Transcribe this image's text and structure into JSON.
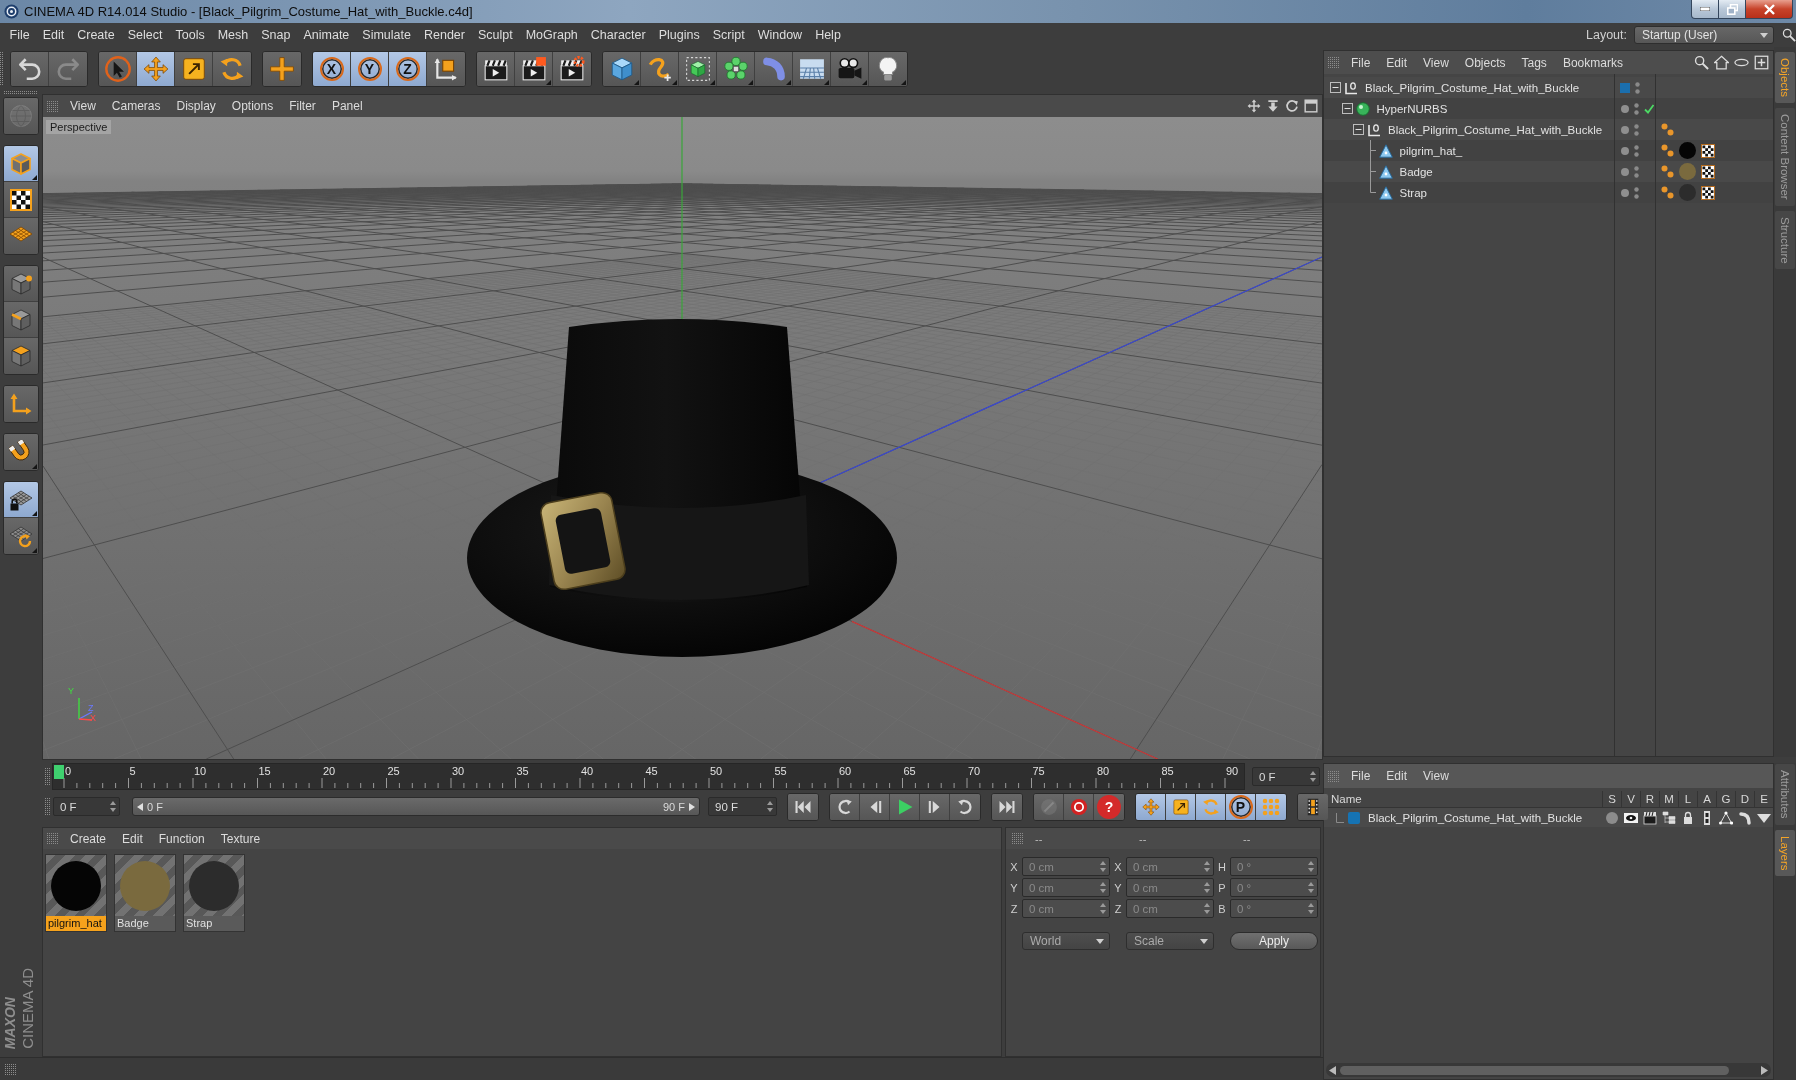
{
  "window": {
    "title": "CINEMA 4D R14.014 Studio - [Black_Pilgrim_Costume_Hat_with_Buckle.c4d]"
  },
  "menu": [
    "File",
    "Edit",
    "Create",
    "Select",
    "Tools",
    "Mesh",
    "Snap",
    "Animate",
    "Simulate",
    "Render",
    "Sculpt",
    "MoGraph",
    "Character",
    "Plugins",
    "Script",
    "Window",
    "Help"
  ],
  "layout": {
    "label": "Layout:",
    "value": "Startup (User)"
  },
  "toolbar": [
    {
      "buttons": [
        {
          "kind": "undo",
          "selected": false,
          "disabled": false
        },
        {
          "kind": "redo",
          "selected": false,
          "disabled": true
        }
      ]
    },
    {
      "buttons": [
        {
          "kind": "select",
          "selected": false
        },
        {
          "kind": "move",
          "selected": true
        },
        {
          "kind": "scale",
          "selected": false
        },
        {
          "kind": "rotate",
          "selected": false
        }
      ]
    },
    {
      "buttons": [
        {
          "kind": "add",
          "selected": false
        }
      ]
    },
    {
      "buttons": [
        {
          "kind": "axis",
          "label": "X",
          "selected": true
        },
        {
          "kind": "axis",
          "label": "Y",
          "selected": true
        },
        {
          "kind": "axis",
          "label": "Z",
          "selected": true
        },
        {
          "kind": "coords",
          "selected": false
        }
      ]
    },
    {
      "buttons": [
        {
          "kind": "render_view",
          "selected": false
        },
        {
          "kind": "render_picture",
          "selected": false
        },
        {
          "kind": "render_settings",
          "selected": false
        }
      ]
    },
    {
      "buttons": [
        {
          "kind": "cube",
          "selected": false
        },
        {
          "kind": "spline",
          "selected": false
        },
        {
          "kind": "nurbs",
          "selected": false
        },
        {
          "kind": "cloner",
          "selected": false
        },
        {
          "kind": "deformer",
          "selected": false
        },
        {
          "kind": "floor",
          "selected": false
        },
        {
          "kind": "camera",
          "selected": false
        },
        {
          "kind": "light",
          "selected": false
        }
      ]
    }
  ],
  "left_toolbar": [
    {
      "buttons": [
        {
          "kind": "globe",
          "selected": false,
          "disabled": true
        }
      ]
    },
    {
      "buttons": [
        {
          "kind": "model",
          "selected": true
        },
        {
          "kind": "texture",
          "selected": false
        },
        {
          "kind": "workplane",
          "selected": false
        }
      ]
    },
    {
      "buttons": [
        {
          "kind": "points",
          "selected": false
        },
        {
          "kind": "edges",
          "selected": false
        },
        {
          "kind": "polygons",
          "selected": false
        }
      ]
    },
    {
      "buttons": [
        {
          "kind": "axis_mode",
          "selected": false
        }
      ]
    },
    {
      "buttons": [
        {
          "kind": "snap",
          "selected": false
        }
      ]
    },
    {
      "buttons": [
        {
          "kind": "workplane_lock",
          "selected": true
        },
        {
          "kind": "planar",
          "selected": false
        }
      ]
    }
  ],
  "viewport": {
    "menu": [
      "View",
      "Cameras",
      "Display",
      "Options",
      "Filter",
      "Panel"
    ],
    "camera": "Perspective",
    "gizmo": [
      "Y",
      "Z",
      "X"
    ]
  },
  "object_manager": {
    "menu": [
      "File",
      "Edit",
      "View",
      "Objects",
      "Tags",
      "Bookmarks"
    ],
    "objects": [
      {
        "name": "Black_Pilgrim_Costume_Hat_with_Buckle",
        "kind": "null",
        "expanded": true,
        "color": "#1b6fae",
        "children": [
          {
            "name": "HyperNURBS",
            "kind": "nurbs",
            "expanded": true,
            "enabled": true,
            "children": [
              {
                "name": "Black_Pilgrim_Costume_Hat_with_Buckle",
                "kind": "null",
                "expanded": true,
                "tags": [
                  {
                    "kind": "phong"
                  }
                ],
                "children": [
                  {
                    "name": "pilgrim_hat_",
                    "kind": "polygon",
                    "tags": [
                      {
                        "kind": "phong"
                      },
                      {
                        "kind": "material",
                        "color": "#050505"
                      },
                      {
                        "kind": "uvw"
                      }
                    ]
                  },
                  {
                    "name": "Badge",
                    "kind": "polygon",
                    "tags": [
                      {
                        "kind": "phong"
                      },
                      {
                        "kind": "material",
                        "color": "#7a6a3e"
                      },
                      {
                        "kind": "uvw"
                      }
                    ]
                  },
                  {
                    "name": "Strap",
                    "kind": "polygon",
                    "tags": [
                      {
                        "kind": "phong"
                      },
                      {
                        "kind": "material",
                        "color": "#2c2c2c"
                      },
                      {
                        "kind": "uvw"
                      }
                    ]
                  }
                ]
              }
            ]
          }
        ]
      }
    ]
  },
  "side_tabs_top": [
    {
      "label": "Objects",
      "selected": true
    },
    {
      "label": "Content Browser",
      "selected": false
    },
    {
      "label": "Structure",
      "selected": false
    }
  ],
  "timeline": {
    "ticks": [
      "0",
      "5",
      "10",
      "15",
      "20",
      "25",
      "30",
      "35",
      "40",
      "45",
      "50",
      "55",
      "60",
      "65",
      "70",
      "75",
      "80",
      "85",
      "90"
    ],
    "playhead": {
      "level": 0
    },
    "current_frame": "0 F"
  },
  "transport": {
    "start": "0 F",
    "preview_range": {
      "start": "0 F",
      "end": "90 F"
    },
    "end": "90 F",
    "groups": [
      {
        "buttons": [
          {
            "kind": "to_start",
            "selected": false
          }
        ]
      },
      {
        "buttons": [
          {
            "kind": "prev_key",
            "selected": false
          },
          {
            "kind": "prev_frame",
            "selected": false
          },
          {
            "kind": "play",
            "selected": false
          },
          {
            "kind": "next_frame",
            "selected": false
          },
          {
            "kind": "next_key",
            "selected": false
          }
        ]
      },
      {
        "buttons": [
          {
            "kind": "to_end",
            "selected": false
          }
        ]
      },
      {
        "buttons": [
          {
            "kind": "key",
            "selected": false,
            "disabled": true
          },
          {
            "kind": "autokey",
            "selected": false,
            "disabled": false
          },
          {
            "kind": "help",
            "label": "?",
            "selected": false,
            "disabled": false
          }
        ]
      },
      {
        "buttons": [
          {
            "kind": "key_move",
            "selected": true
          },
          {
            "kind": "key_scale",
            "selected": true
          },
          {
            "kind": "key_rotate",
            "selected": true
          },
          {
            "kind": "param",
            "label": "P",
            "selected": true
          },
          {
            "kind": "key_points",
            "selected": true
          }
        ]
      },
      {
        "buttons": [
          {
            "kind": "timeline",
            "selected": false
          }
        ]
      }
    ]
  },
  "material_manager": {
    "menu": [
      "Create",
      "Edit",
      "Function",
      "Texture"
    ],
    "materials": [
      {
        "name": "pilgrim_hat",
        "color": "#050505",
        "selected": true
      },
      {
        "name": "Badge",
        "color": "#7a6a3e",
        "selected": false
      },
      {
        "name": "Strap",
        "color": "#2c2c2c",
        "selected": false
      }
    ]
  },
  "coordinates": {
    "headers": [
      "--",
      "--",
      "--"
    ],
    "disabled": true,
    "rows": [
      {
        "position_axis": "X",
        "position": "0 cm",
        "size_axis": "X",
        "size": "0 cm",
        "rotation_axis": "H",
        "rotation": "0 °"
      },
      {
        "position_axis": "Y",
        "position": "0 cm",
        "size_axis": "Y",
        "size": "0 cm",
        "rotation_axis": "P",
        "rotation": "0 °"
      },
      {
        "position_axis": "Z",
        "position": "0 cm",
        "size_axis": "Z",
        "size": "0 cm",
        "rotation_axis": "B",
        "rotation": "0 °"
      }
    ],
    "space": "World",
    "mode": "Scale",
    "apply": "Apply"
  },
  "layer_manager": {
    "menu": [
      "File",
      "Edit",
      "View"
    ],
    "columns": [
      "Name",
      "S",
      "V",
      "R",
      "M",
      "L",
      "A",
      "G",
      "D",
      "E"
    ],
    "layers": [
      {
        "name": "Black_Pilgrim_Costume_Hat_with_Buckle",
        "color": "#1673b3"
      }
    ]
  },
  "side_tabs_bottom": [
    {
      "label": "Attributes",
      "selected": false
    },
    {
      "label": "Layers",
      "selected": true
    }
  ],
  "logo": {
    "brand": "MAXON",
    "product": "CINEMA 4D"
  }
}
